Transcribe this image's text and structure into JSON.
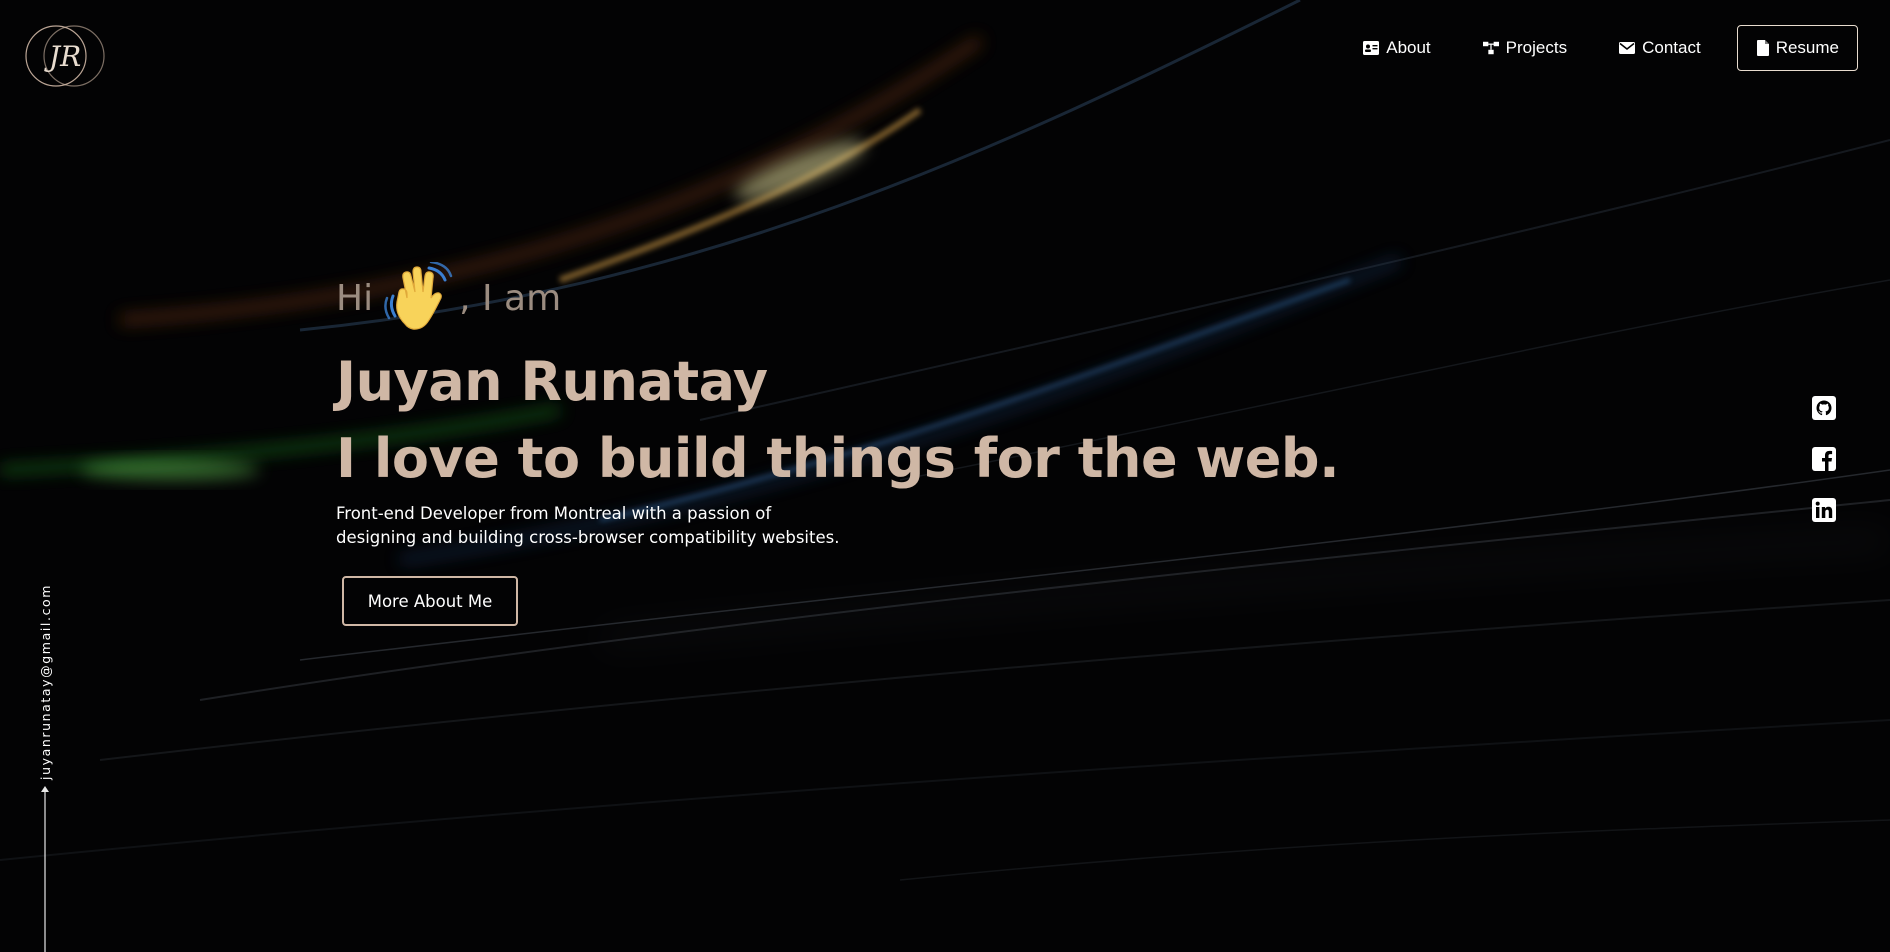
{
  "logo": {
    "monogram": "JR"
  },
  "nav": {
    "items": [
      {
        "label": "About",
        "icon": "id-card-icon"
      },
      {
        "label": "Projects",
        "icon": "sitemap-icon"
      },
      {
        "label": "Contact",
        "icon": "envelope-icon"
      }
    ],
    "resume": {
      "label": "Resume",
      "icon": "file-icon"
    }
  },
  "hero": {
    "greeting_pre": "Hi",
    "greeting_emoji": "waving-hand-icon",
    "greeting_post": ", I am",
    "name": "Juyan Runatay",
    "tagline": "I love to build things for the web.",
    "description_line1": "Front-end Developer from Montreal with a passion of",
    "description_line2": "designing and building cross-browser compatibility websites.",
    "cta_label": "More About Me"
  },
  "socials": [
    {
      "name": "github-icon"
    },
    {
      "name": "facebook-icon"
    },
    {
      "name": "linkedin-icon"
    }
  ],
  "sidebar": {
    "email": "juyanrunatay@gmail.com"
  },
  "colors": {
    "background": "#030304",
    "accent": "#cfb7a5",
    "greeting": "#9b8c80",
    "text": "#ffffff"
  }
}
